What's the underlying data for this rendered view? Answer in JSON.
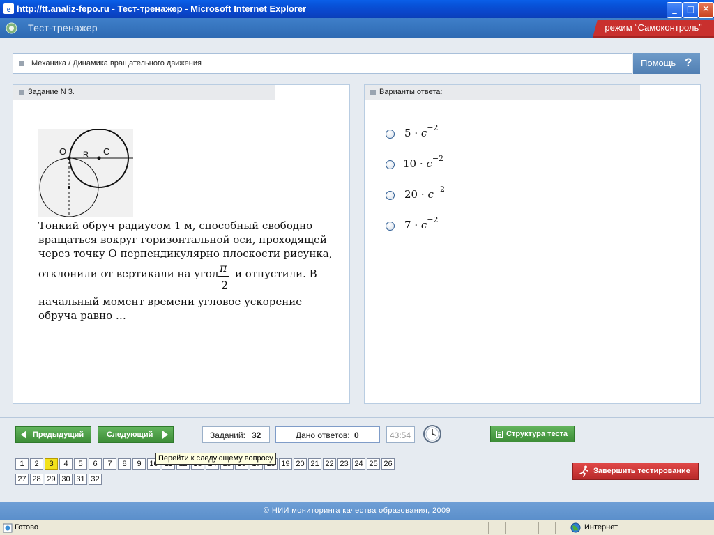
{
  "window": {
    "title": "http://tt.analiz-fepo.ru - Тест-тренажер - Microsoft Internet Explorer",
    "controls": {
      "minimize": "_",
      "maximize": "□",
      "close": "✕"
    }
  },
  "app": {
    "title": "Тест-тренажер",
    "mode": "режим “Самоконтроль”"
  },
  "breadcrumb": {
    "text": "Механика / Динамика вращательного движения"
  },
  "help": {
    "label": "Помощь",
    "icon_glyph": "?"
  },
  "task": {
    "header": "Задание N 3.",
    "figure": {
      "label_o": "O",
      "label_r": "R",
      "label_c": "C"
    },
    "lines": [
      "Тонкий обруч радиусом 1 м, способный свободно",
      "вращаться вокруг горизонтальной оси, проходящей",
      "через точку О перпендикулярно плоскости рисунка,",
      "отклонили от вертикали на угол",
      "и отпустили.  В",
      "начальный момент времени угловое ускорение",
      "обруча равно …"
    ],
    "angle": {
      "numerator": "π",
      "denominator": "2"
    }
  },
  "answers": {
    "header": "Варианты ответа:",
    "options": [
      {
        "coef": "5",
        "dot": "·",
        "unit": "c",
        "exp": "−2",
        "selected": false
      },
      {
        "coef": "10",
        "dot": "·",
        "unit": "c",
        "exp": "−2",
        "selected": false
      },
      {
        "coef": "20",
        "dot": "·",
        "unit": "c",
        "exp": "−2",
        "selected": false
      },
      {
        "coef": "7",
        "dot": "·",
        "unit": "c",
        "exp": "−2",
        "selected": false
      }
    ]
  },
  "toolbar": {
    "prev_label": "Предыдущий",
    "next_label": "Следующий",
    "tasks_label": "Заданий:",
    "tasks_count": "32",
    "answered_label": "Дано ответов:",
    "answered_count": "0",
    "timer": "43:54",
    "structure_label": "Структура теста",
    "finish_label": "Завершить тестирование",
    "tooltip": "Перейти к следующему вопросу"
  },
  "pages": {
    "current": 3,
    "items": [
      "1",
      "2",
      "3",
      "4",
      "5",
      "6",
      "7",
      "8",
      "9",
      "10",
      "11",
      "12",
      "13",
      "14",
      "15",
      "16",
      "17",
      "18",
      "19",
      "20",
      "21",
      "22",
      "23",
      "24",
      "25",
      "26",
      "27",
      "28",
      "29",
      "30",
      "31",
      "32"
    ]
  },
  "footer": {
    "text": "© НИИ мониторинга качества образования, 2009"
  },
  "statusbar": {
    "status": "Готово",
    "zone": "Интернет"
  },
  "colors": {
    "title_bar": "#0a52d8",
    "app_bar": "#3a78c2",
    "mode_badge": "#c9302e",
    "green_button": "#4a9a44",
    "red_button": "#c83434",
    "active_page": "#f3e21a"
  }
}
